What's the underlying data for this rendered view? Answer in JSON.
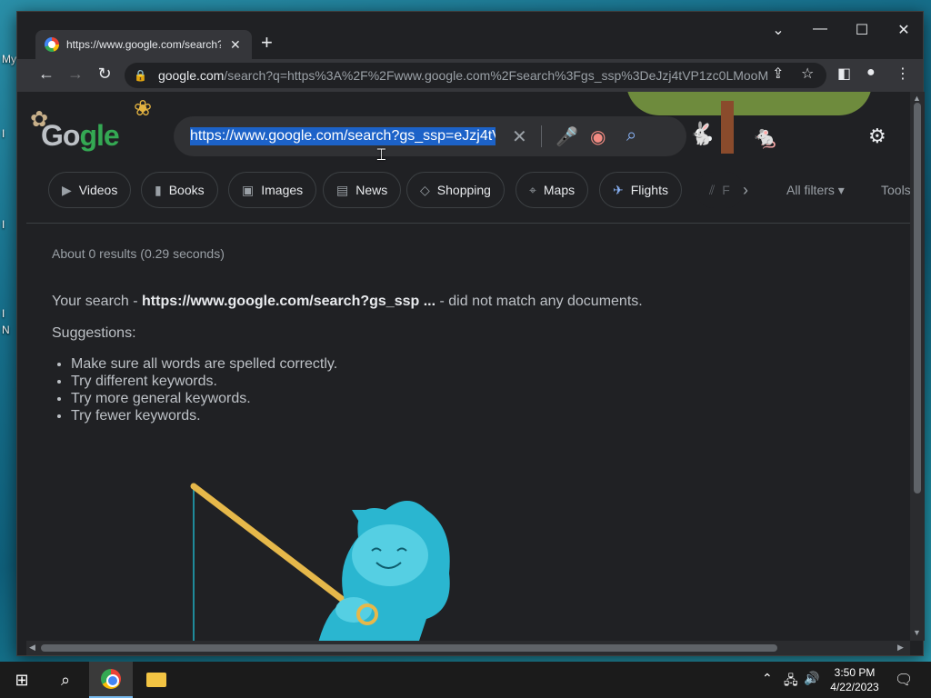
{
  "desktop": {
    "labels": [
      "My",
      "I",
      "I",
      "I",
      "N"
    ]
  },
  "tab": {
    "title": "https://www.google.com/search?"
  },
  "omnibox": {
    "host": "google.com",
    "rest": "/search?q=https%3A%2F%2Fwww.google.com%2Fsearch%3Fgs_ssp%3DeJzj4tVP1zc0LMooMD..."
  },
  "search": {
    "query": "https://www.google.com/search?gs_ssp=eJzj4tV"
  },
  "logo": {
    "text_a": "Go",
    "text_b": "gle"
  },
  "chips": [
    {
      "label": "Videos",
      "icon": "play-icon"
    },
    {
      "label": "Books",
      "icon": "book-icon"
    },
    {
      "label": "Images",
      "icon": "image-icon"
    },
    {
      "label": "News",
      "icon": "news-icon"
    },
    {
      "label": "Shopping",
      "icon": "tag-icon"
    },
    {
      "label": "Maps",
      "icon": "pin-icon"
    },
    {
      "label": "Flights",
      "icon": "plane-icon"
    },
    {
      "label": "F",
      "icon": "chart-icon"
    }
  ],
  "filters": {
    "all_filters": "All filters",
    "tools": "Tools"
  },
  "results": {
    "stats": "About 0 results (0.29 seconds)",
    "prefix": "Your search - ",
    "query_bold": "https://www.google.com/search?gs_ssp ...",
    "suffix": " - did not match any documents.",
    "suggestions_heading": "Suggestions:",
    "suggestions": [
      "Make sure all words are spelled correctly.",
      "Try different keywords.",
      "Try more general keywords.",
      "Try fewer keywords."
    ]
  },
  "taskbar": {
    "time": "3:50 PM",
    "date": "4/22/2023"
  },
  "colors": {
    "accent": "#8ab4f8",
    "selection": "#1c62c8",
    "page_bg": "#202124"
  }
}
